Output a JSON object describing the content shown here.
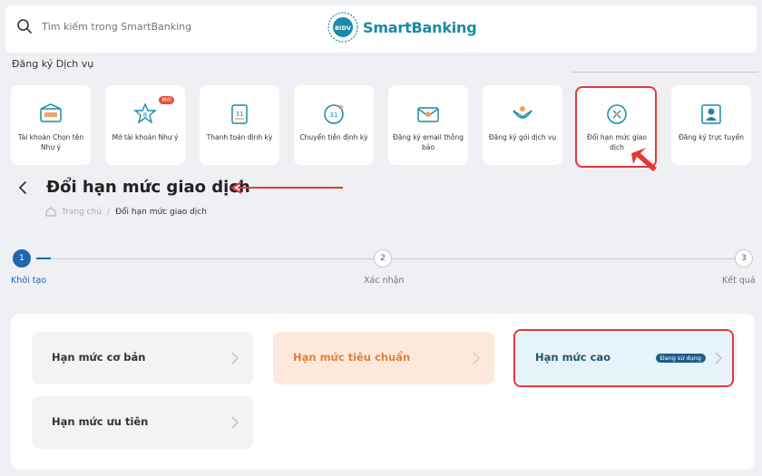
{
  "header": {
    "search_placeholder": "Tìm kiếm trong SmartBanking",
    "brand_name": "SmartBanking",
    "brand_badge": "BIDV"
  },
  "services": {
    "title": "Đăng ký Dịch vụ",
    "items": [
      {
        "label": "Tài khoản Chọn tên Như ý",
        "icon": "account-name-icon"
      },
      {
        "label": "Mở tài khoản Như ý",
        "icon": "lucky-number-icon",
        "badge": "Mới"
      },
      {
        "label": "Thanh toán định kỳ",
        "icon": "calendar-payment-icon"
      },
      {
        "label": "Chuyển tiền định kỳ",
        "icon": "scheduled-transfer-icon"
      },
      {
        "label": "Đăng ký email thông báo",
        "icon": "email-notification-icon"
      },
      {
        "label": "Đăng ký gói dịch vụ",
        "icon": "service-package-icon"
      },
      {
        "label": "Đổi hạn mức giao dịch",
        "icon": "transaction-limit-icon"
      },
      {
        "label": "Đăng ký trực tuyến",
        "icon": "online-registration-icon"
      }
    ]
  },
  "page": {
    "title": "Đổi hạn mức giao dịch",
    "breadcrumb_home": "Trang chủ",
    "breadcrumb_separator": "/",
    "breadcrumb_current": "Đổi hạn mức giao dịch"
  },
  "stepper": {
    "steps": [
      {
        "number": "1",
        "label": "Khởi tạo"
      },
      {
        "number": "2",
        "label": "Xác nhận"
      },
      {
        "number": "3",
        "label": "Kết quả"
      }
    ],
    "active_step": 1
  },
  "limits": {
    "options": [
      {
        "label": "Hạn mức cơ bản"
      },
      {
        "label": "Hạn mức tiêu chuẩn"
      },
      {
        "label": "Hạn mức cao",
        "status": "Đang sử dụng"
      },
      {
        "label": "Hạn mức ưu tiên"
      }
    ]
  },
  "colors": {
    "accent_blue": "#1f66b0",
    "brand_teal": "#1b8aa6",
    "highlight_red": "#e53935",
    "standard_orange": "#e0803f"
  }
}
